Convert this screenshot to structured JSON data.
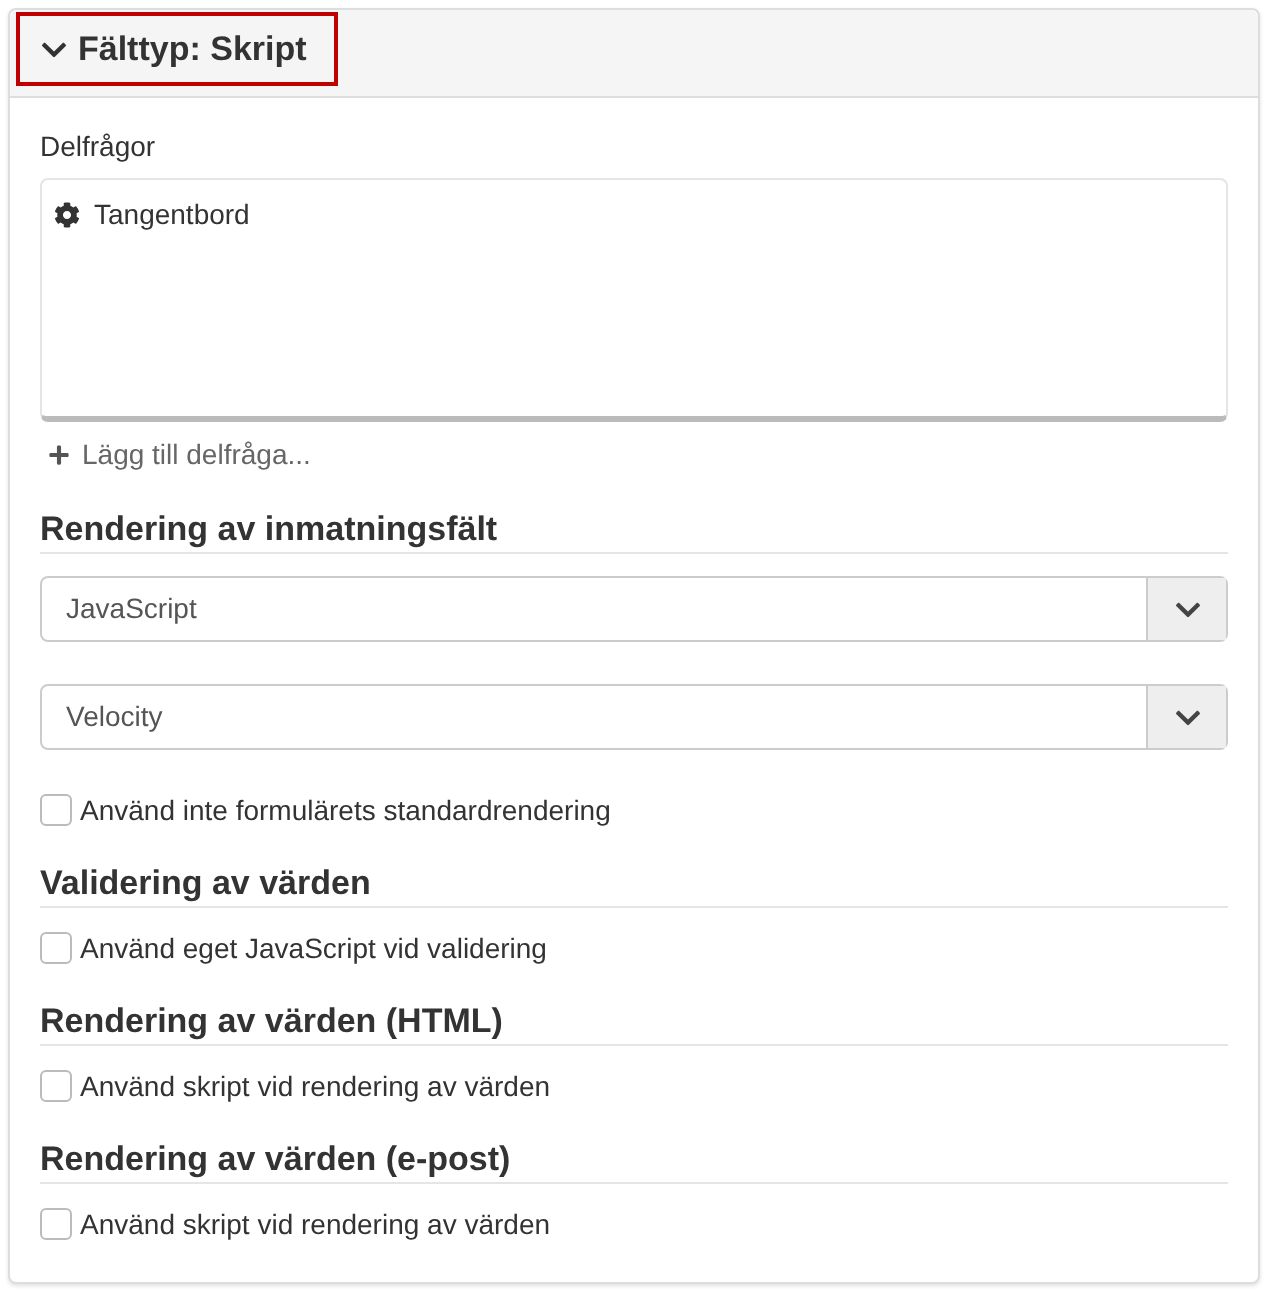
{
  "header": {
    "title": "Fälttyp: Skript",
    "expanded": true
  },
  "subquestions": {
    "label": "Delfrågor",
    "items": [
      {
        "label": "Tangentbord"
      }
    ],
    "add_link": "Lägg till delfråga..."
  },
  "sections": [
    {
      "heading": "Rendering av inmatningsfält",
      "controls": [
        {
          "kind": "select",
          "value": "JavaScript"
        },
        {
          "kind": "select",
          "value": "Velocity"
        },
        {
          "kind": "checkbox",
          "label": "Använd inte formulärets standardrendering",
          "checked": false
        }
      ]
    },
    {
      "heading": "Validering av värden",
      "controls": [
        {
          "kind": "checkbox",
          "label": "Använd eget JavaScript vid validering",
          "checked": false
        }
      ]
    },
    {
      "heading": "Rendering av värden (HTML)",
      "controls": [
        {
          "kind": "checkbox",
          "label": "Använd skript vid rendering av värden",
          "checked": false
        }
      ]
    },
    {
      "heading": "Rendering av värden (e-post)",
      "controls": [
        {
          "kind": "checkbox",
          "label": "Använd skript vid rendering av värden",
          "checked": false
        }
      ]
    }
  ]
}
